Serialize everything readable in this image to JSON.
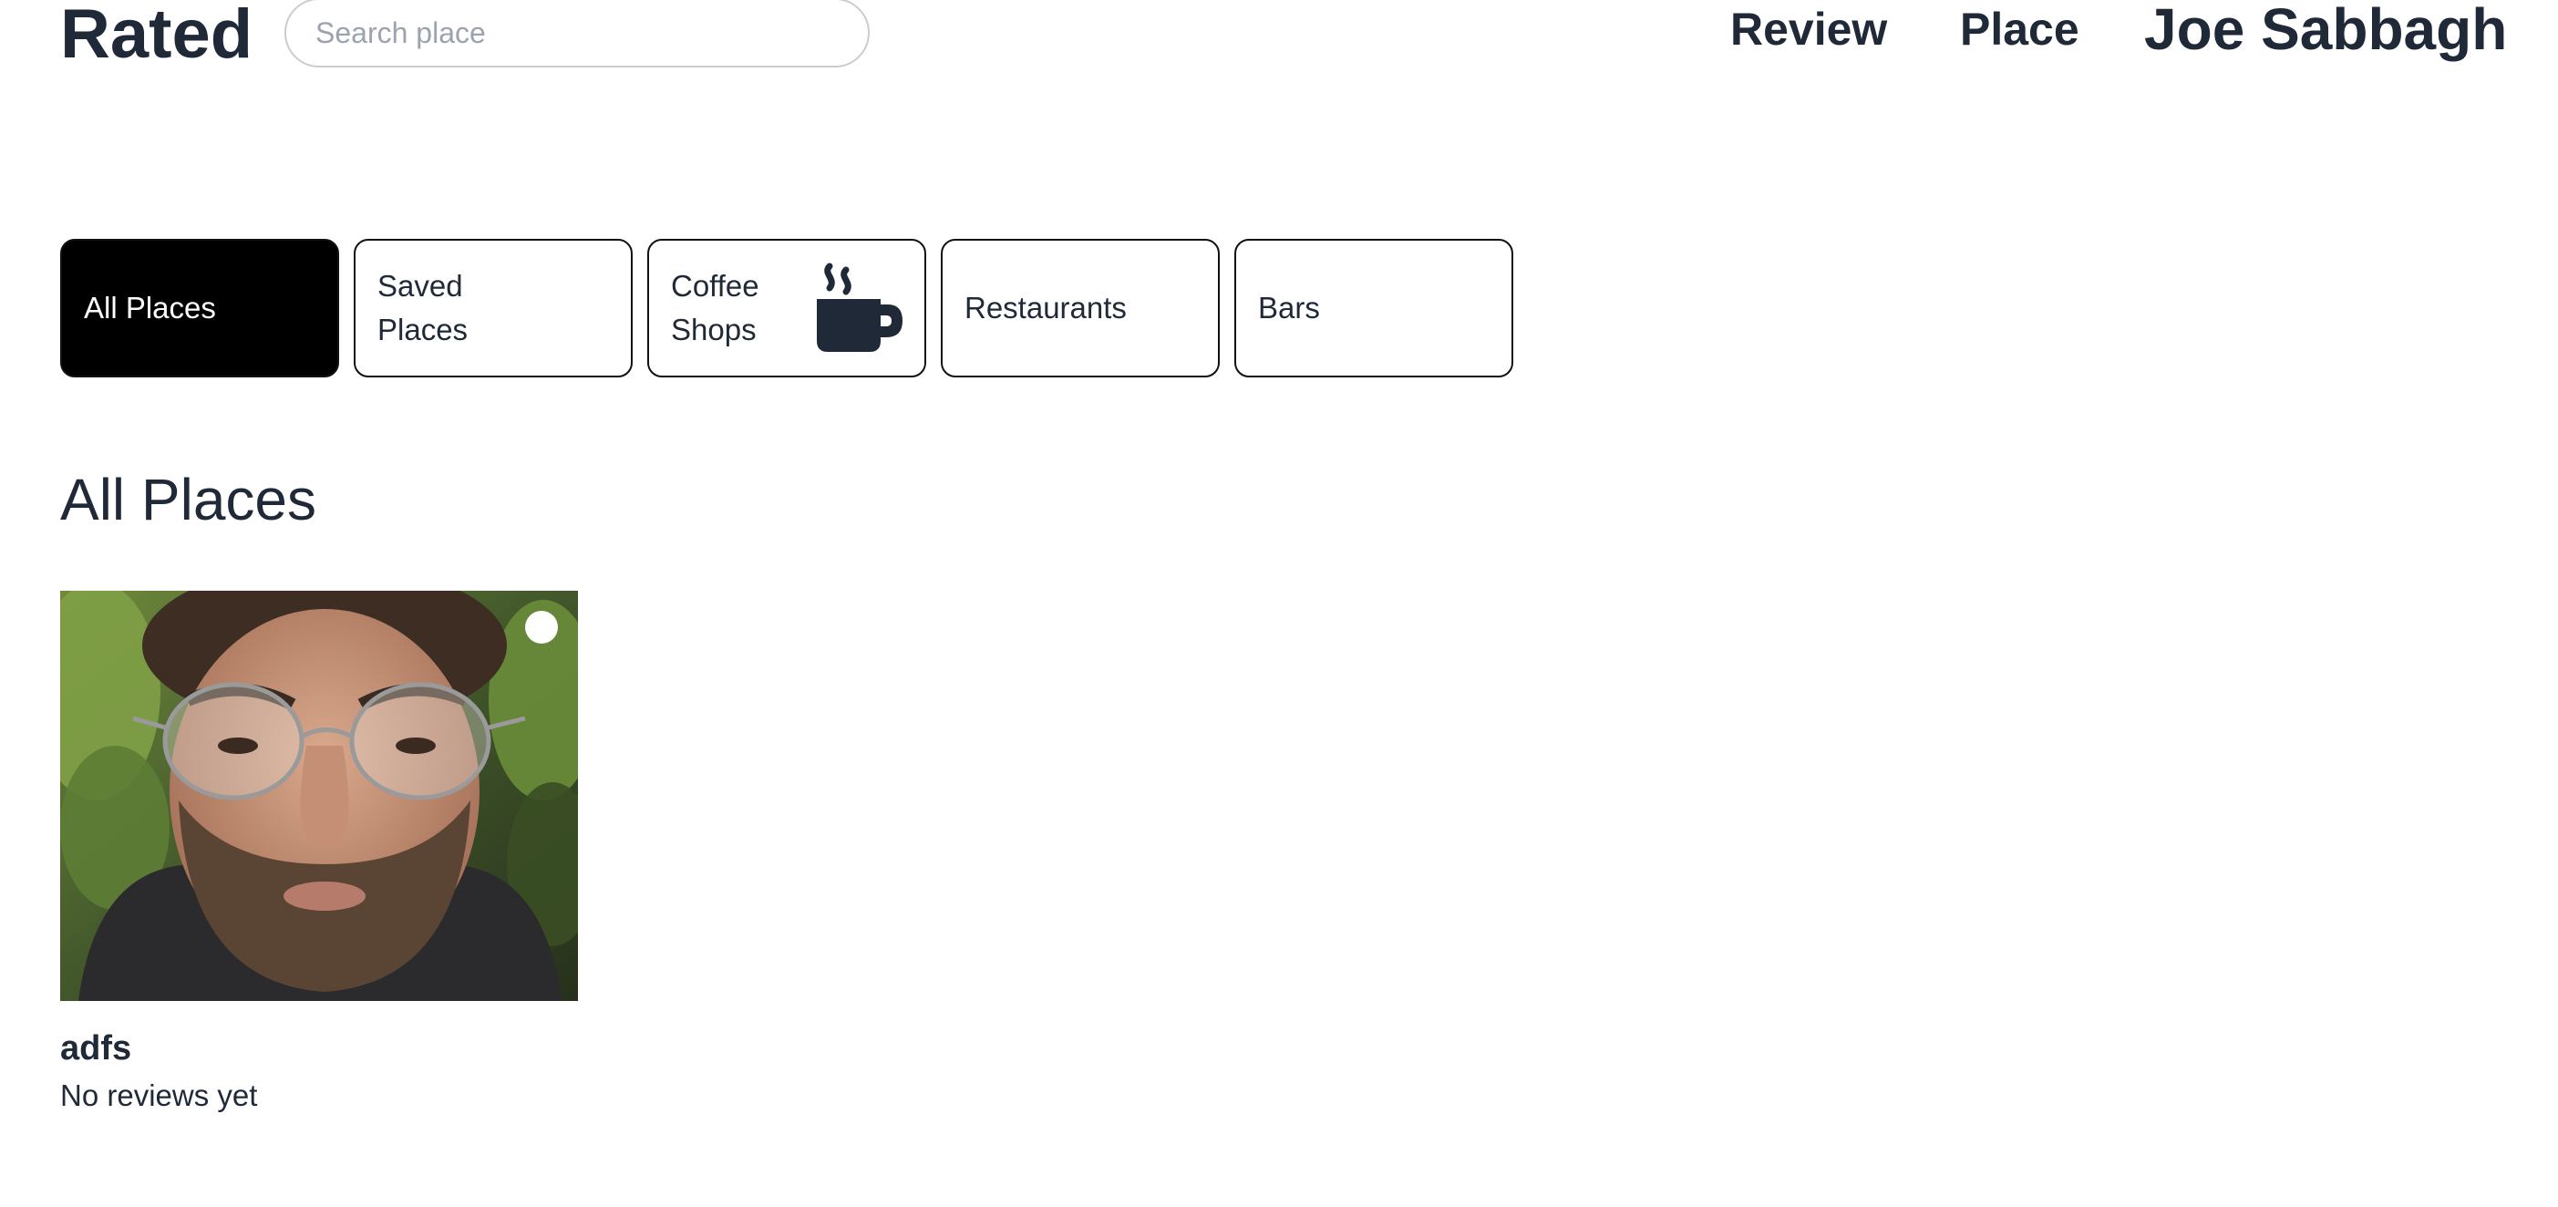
{
  "header": {
    "brand": "Rated",
    "search": {
      "placeholder": "Search place",
      "value": ""
    },
    "nav": {
      "review": "Review",
      "place": "Place",
      "user": "Joe Sabbagh"
    }
  },
  "categories": [
    {
      "label": "All Places",
      "active": true
    },
    {
      "label": "Saved Places",
      "active": false
    },
    {
      "label": "Coffee Shops",
      "active": false,
      "icon": "coffee-cup-icon"
    },
    {
      "label": "Restaurants",
      "active": false
    },
    {
      "label": "Bars",
      "active": false
    }
  ],
  "section": {
    "title": "All Places"
  },
  "places": [
    {
      "name": "adfs",
      "reviews_text": "No reviews yet",
      "photo": "profile-photo"
    }
  ]
}
